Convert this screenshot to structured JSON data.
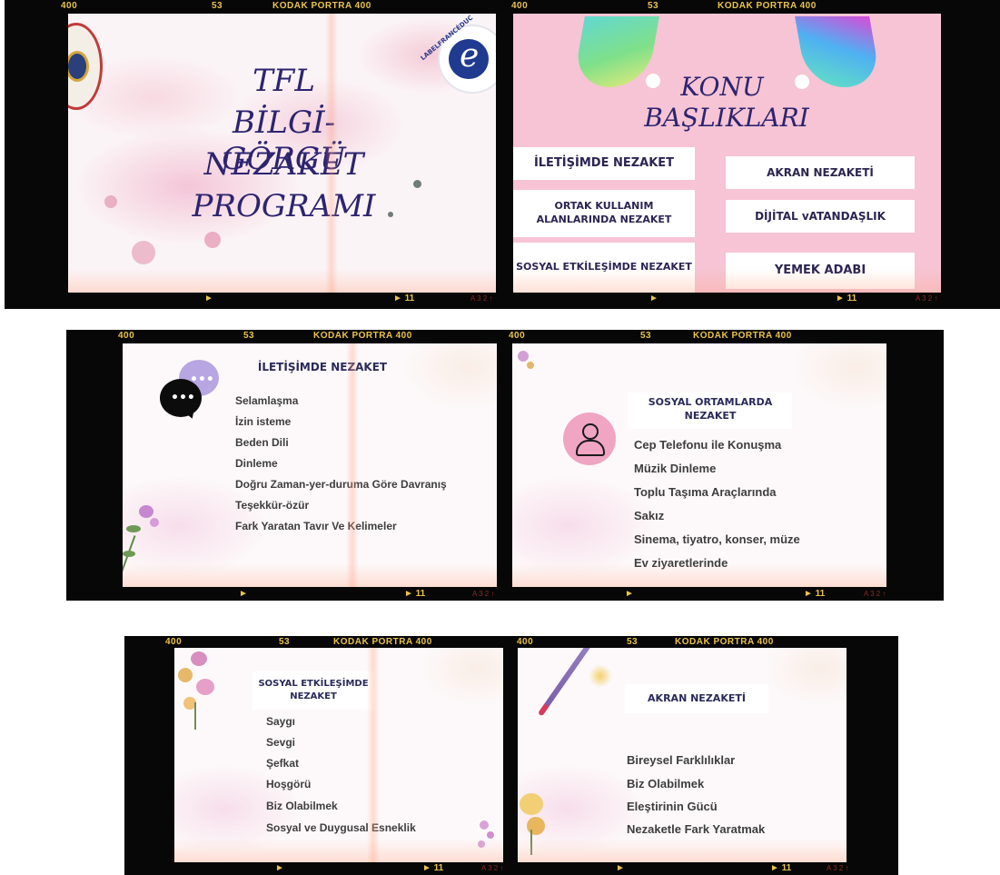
{
  "film": {
    "iso": "400",
    "frame": "53",
    "brand": "KODAK PORTRA 400",
    "arrow": "►",
    "frame_bottom": "► 11",
    "code": "A 3 2 ↑"
  },
  "slide1": {
    "title_lines": [
      "TFL",
      "BİLGİ-GÖRGÜ",
      "NEZAKET",
      "PROGRAMI"
    ],
    "logo_text": "LABELFRANCÉDUC",
    "logo_letter": "e"
  },
  "slide2": {
    "title_lines": [
      "KONU",
      "BAŞLIKLARI"
    ],
    "topics": [
      "İLETİŞİMDE NEZAKET",
      "ORTAK KULLANIM ALANLARINDA NEZAKET",
      "SOSYAL ETKİLEŞİMDE NEZAKET",
      "AKRAN NEZAKETİ",
      "DİJİTAL vATANDAŞLIK",
      "YEMEK ADABI"
    ]
  },
  "slide3": {
    "title": "İLETİŞİMDE NEZAKET",
    "items": [
      "Selamlaşma",
      "İzin isteme",
      "Beden Dili",
      "Dinleme",
      "Doğru Zaman-yer-duruma Göre Davranış",
      "Teşekkür-özür",
      "Fark Yaratan Tavır Ve Kelimeler"
    ]
  },
  "slide4": {
    "title": "SOSYAL ORTAMLARDA NEZAKET",
    "items": [
      "Cep Telefonu ile Konuşma",
      "Müzik Dinleme",
      "Toplu Taşıma Araçlarında",
      "Sakız",
      "Sinema, tiyatro, konser, müze",
      "Ev ziyaretlerinde"
    ]
  },
  "slide5": {
    "title": "SOSYAL ETKİLEŞİMDE NEZAKET",
    "items": [
      "Saygı",
      "Sevgi",
      "Şefkat",
      "Hoşgörü",
      "Biz Olabilmek",
      "Sosyal ve Duygusal Esneklik"
    ]
  },
  "slide6": {
    "title": "AKRAN NEZAKETİ",
    "items": [
      "Bireysel Farklılıklar",
      "Biz Olabilmek",
      "Eleştirinin Gücü",
      "Nezaketle Fark Yaratmak"
    ]
  },
  "colors": {
    "film": "#070707",
    "film_text": "#e9c34a",
    "script_text": "#2d2470",
    "slide2_bg": "#f6c4d4",
    "box_text": "#2c2452"
  }
}
